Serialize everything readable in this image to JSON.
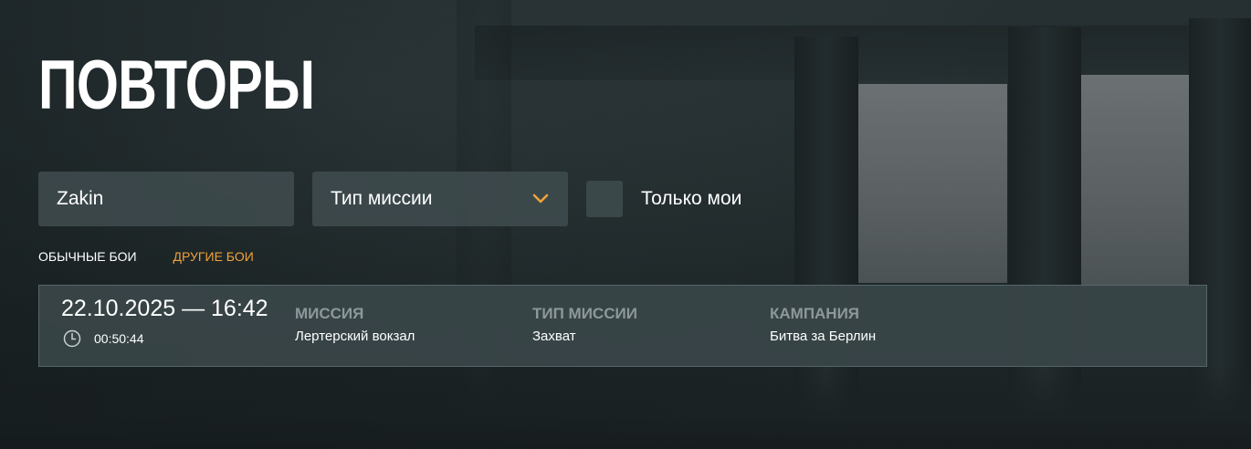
{
  "page": {
    "title": "ПОВТОРЫ"
  },
  "filters": {
    "search": {
      "value": "Zakin",
      "placeholder": ""
    },
    "mission_type": {
      "selected": "Тип миссии",
      "icon": "chevron-down-icon"
    },
    "only_mine": {
      "label": "Только мои",
      "checked": false
    }
  },
  "tabs": [
    {
      "label": "ОБЫЧНЫЕ БОИ",
      "active": false
    },
    {
      "label": "ДРУГИЕ БОИ",
      "active": true
    }
  ],
  "replays": [
    {
      "datetime": "22.10.2025 — 16:42",
      "duration": "00:50:44",
      "mission_header": "МИССИЯ",
      "mission": "Лертерский вокзал",
      "type_header": "ТИП МИССИИ",
      "type": "Захват",
      "campaign_header": "КАМПАНИЯ",
      "campaign": "Битва за Берлин"
    }
  ],
  "colors": {
    "accent": "#f0a23a",
    "field_bg": "#404c4f",
    "row_bg": "#3a4649",
    "muted_header": "#8d989b"
  }
}
